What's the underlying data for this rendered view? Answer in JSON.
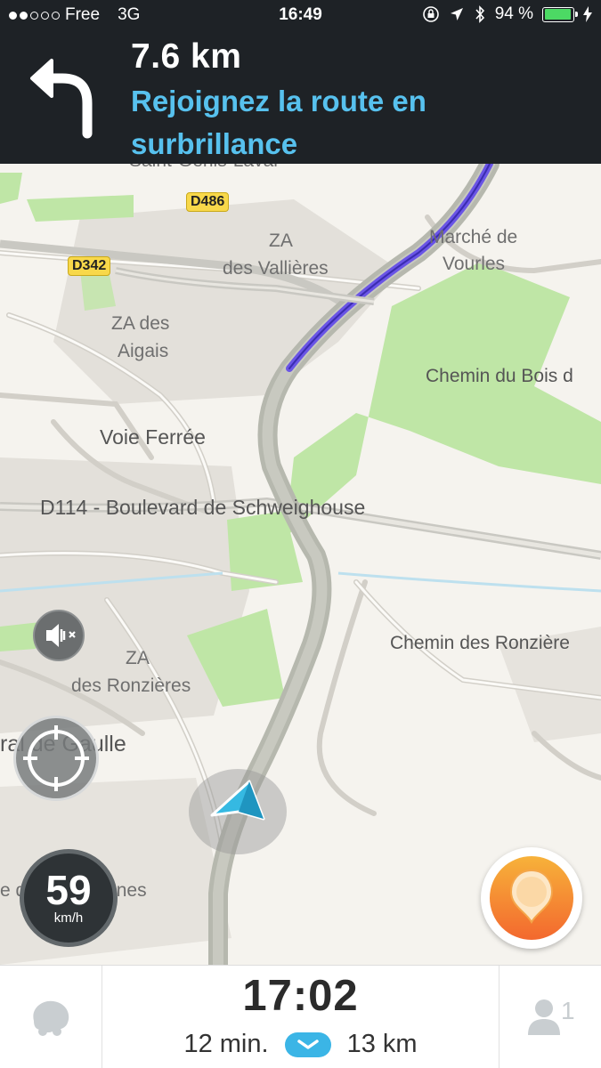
{
  "status_bar": {
    "carrier": "Free",
    "network": "3G",
    "time": "16:49",
    "battery_pct": "94 %",
    "battery_level": 0.94,
    "battery_color": "#4cd964"
  },
  "instruction": {
    "distance": "7.6 km",
    "text": "Rejoignez la route en surbrillance",
    "icon": "turn-left-arrow-icon",
    "text_color": "#57c1ee"
  },
  "map": {
    "labels": {
      "za_vallieres_1": "ZA",
      "za_vallieres_2": "des Vallières",
      "marche_1": "Marché de",
      "marche_2": "Vourles",
      "za_aigais_1": "ZA des",
      "za_aigais_2": "Aigais",
      "chemin_bois": "Chemin du Bois d",
      "voie_ferree": "Voie Ferrée",
      "d114": "D114 - Boulevard de Schweighouse",
      "chemin_ronzieres": "Chemin des Ronzière",
      "za_ronzieres_1": "ZA",
      "za_ronzieres_2": "des Ronzières",
      "gaulle": "ral de Gaulle",
      "communes": "e des Communes",
      "top_cut": "Saint-Genis-Laval"
    },
    "shields": {
      "d486": "D486",
      "d342": "D342"
    },
    "route_color": "#6a55e6",
    "green_color": "#bfe6a6"
  },
  "controls": {
    "sound_icon": "sound-muted-icon",
    "recenter_icon": "recenter-crosshair-icon",
    "speed_value": "59",
    "speed_unit": "km/h",
    "report_icon": "report-pin-icon",
    "accent_color": "#f3682e"
  },
  "bottom_bar": {
    "eta": "17:02",
    "duration": "12 min.",
    "distance": "13 km",
    "menu_icon": "waze-menu-icon",
    "users_icon": "user-icon",
    "users_count": "1",
    "chevron_icon": "chevron-down-icon"
  }
}
